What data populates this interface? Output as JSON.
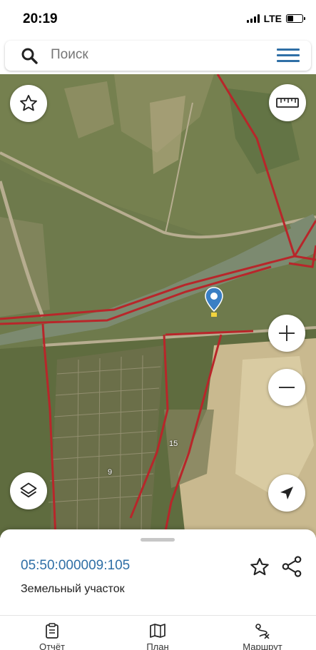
{
  "status": {
    "time": "20:19",
    "network": "LTE",
    "battery_level": 0.35
  },
  "search": {
    "placeholder": "Поиск"
  },
  "map": {
    "labels": [
      {
        "text": "15"
      },
      {
        "text": "9"
      }
    ],
    "colors": {
      "boundary": "#b8262a",
      "accent": "#2f6fa6"
    }
  },
  "details": {
    "cadastral_number": "05:50:000009:105",
    "type": "Земельный участок"
  },
  "tabs": [
    {
      "label": "Отчёт"
    },
    {
      "label": "План"
    },
    {
      "label": "Маршрут"
    }
  ]
}
